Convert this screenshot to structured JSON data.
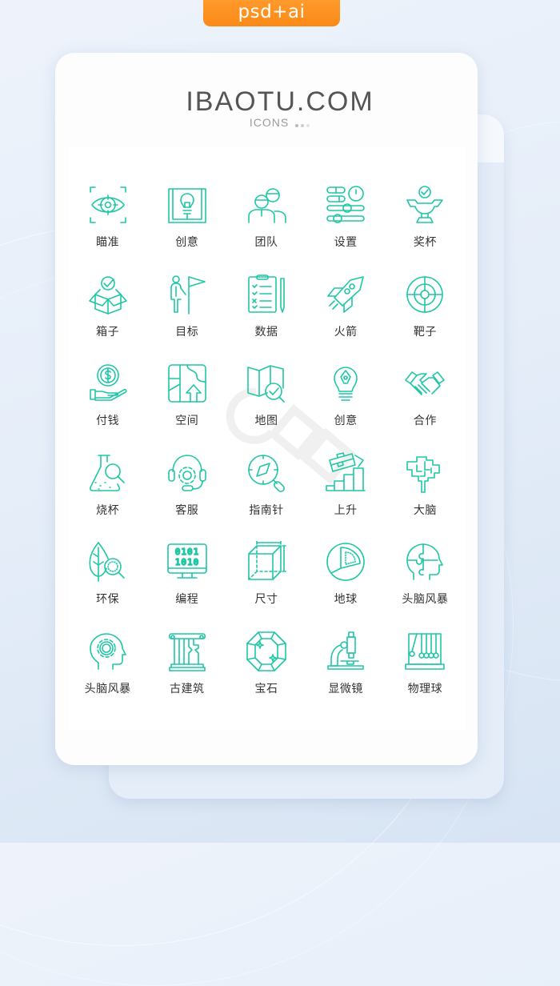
{
  "badge": {
    "label": "psd+ai",
    "color": "#fb8a17"
  },
  "header": {
    "brand": "IBAOTU.COM",
    "subtitle": "ICONS"
  },
  "accent_color": "#1fc7a5",
  "icons": [
    {
      "icon": "eye-target-icon",
      "label": "瞄准"
    },
    {
      "icon": "lightbulb-book-icon",
      "label": "创意"
    },
    {
      "icon": "team-icon",
      "label": "团队"
    },
    {
      "icon": "settings-sliders-icon",
      "label": "设置"
    },
    {
      "icon": "trophy-icon",
      "label": "奖杯"
    },
    {
      "icon": "box-check-icon",
      "label": "箱子"
    },
    {
      "icon": "person-flag-icon",
      "label": "目标"
    },
    {
      "icon": "clipboard-checklist-icon",
      "label": "数据"
    },
    {
      "icon": "rocket-icon",
      "label": "火箭"
    },
    {
      "icon": "target-icon",
      "label": "靶子"
    },
    {
      "icon": "hand-coin-icon",
      "label": "付钱"
    },
    {
      "icon": "map-arrow-icon",
      "label": "空间"
    },
    {
      "icon": "map-check-icon",
      "label": "地图"
    },
    {
      "icon": "bulb-pen-icon",
      "label": "创意"
    },
    {
      "icon": "handshake-icon",
      "label": "合作"
    },
    {
      "icon": "flask-search-icon",
      "label": "烧杯"
    },
    {
      "icon": "headset-gear-icon",
      "label": "客服"
    },
    {
      "icon": "compass-search-icon",
      "label": "指南针"
    },
    {
      "icon": "briefcase-growth-icon",
      "label": "上升"
    },
    {
      "icon": "brain-icon",
      "label": "大脑"
    },
    {
      "icon": "leaf-search-icon",
      "label": "环保"
    },
    {
      "icon": "monitor-binary-icon",
      "label": "编程"
    },
    {
      "icon": "cube-dimension-icon",
      "label": "尺寸"
    },
    {
      "icon": "earth-core-icon",
      "label": "地球"
    },
    {
      "icon": "head-puzzle-icon",
      "label": "头脑风暴"
    },
    {
      "icon": "head-gear-icon",
      "label": "头脑风暴"
    },
    {
      "icon": "column-ruin-icon",
      "label": "古建筑"
    },
    {
      "icon": "gem-icon",
      "label": "宝石"
    },
    {
      "icon": "microscope-icon",
      "label": "显微镜"
    },
    {
      "icon": "newtons-cradle-icon",
      "label": "物理球"
    }
  ]
}
